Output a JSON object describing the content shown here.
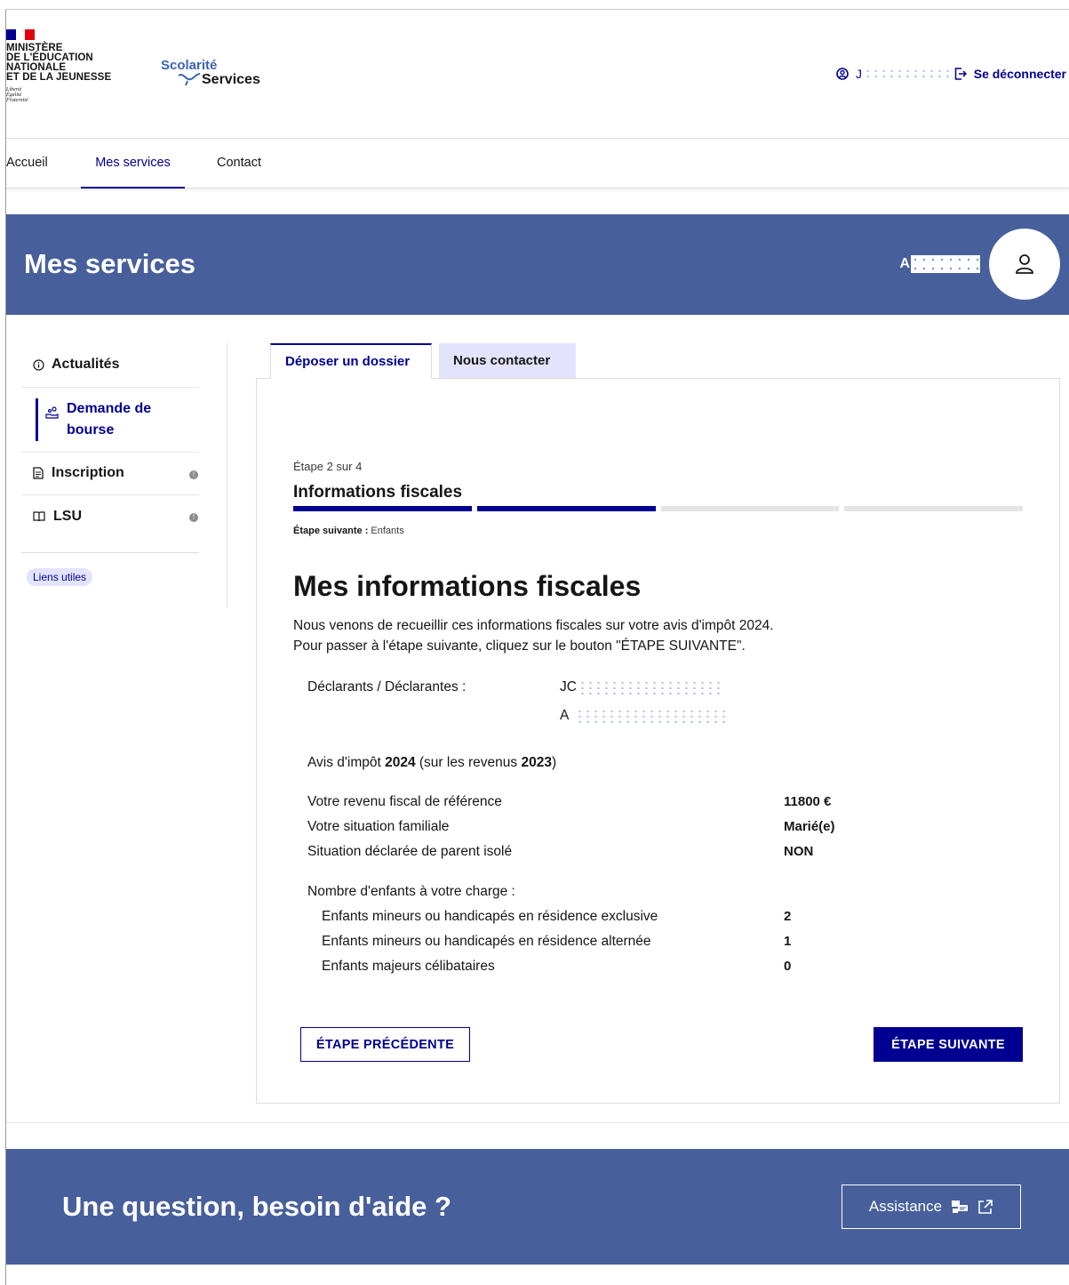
{
  "header": {
    "ministry_lines": [
      "MINISTÈRE",
      "DE L'ÉDUCATION",
      "NATIONALE",
      "ET DE LA JEUNESSE"
    ],
    "motto_lines": [
      "Liberté",
      "Égalité",
      "Fraternité"
    ],
    "logo_top": "Scolarité",
    "logo_bottom": "Services",
    "user_initial": "J",
    "logout_label": "Se déconnecter"
  },
  "nav": {
    "items": [
      "Accueil",
      "Mes services",
      "Contact"
    ],
    "active": "Mes services"
  },
  "banner": {
    "title": "Mes services",
    "user_initials": "A"
  },
  "sidebar": {
    "items": [
      {
        "label": "Actualités",
        "icon": "info-icon"
      },
      {
        "label": "Demande de bourse",
        "icon": "hand-coins-icon",
        "active": true
      },
      {
        "label": "Inscription",
        "icon": "document-icon",
        "alert": true
      },
      {
        "label": "LSU",
        "icon": "book-icon",
        "alert": true
      }
    ],
    "tag": "Liens utiles"
  },
  "tabs": [
    "Déposer un dossier",
    "Nous contacter"
  ],
  "stepper": {
    "count": "Étape 2 sur 4",
    "title": "Informations fiscales",
    "current": 2,
    "total": 4,
    "next_label": "Étape suivante :",
    "next_value": "Enfants"
  },
  "content": {
    "title": "Mes informations fiscales",
    "intro_1": "Nous venons de recueillir ces informations fiscales sur votre avis d'impôt 2024.",
    "intro_2": "Pour passer à l'étape suivante, cliquez sur le bouton \"ÉTAPE SUIVANTE\".",
    "declarants_label": "Déclarants / Déclarantes :",
    "declarant_1": "JC",
    "declarant_2": "A",
    "avis_prefix": "Avis d'impôt ",
    "avis_year": "2024",
    "avis_mid": " (sur les revenus ",
    "revenus_year": "2023",
    "avis_suffix": ")",
    "rows": [
      {
        "label": "Votre revenu fiscal de référence",
        "value": "11800 €"
      },
      {
        "label": "Votre situation familiale",
        "value": "Marié(e)"
      },
      {
        "label": "Situation déclarée de parent isolé",
        "value": "NON"
      }
    ],
    "children_label": "Nombre d'enfants à votre charge :",
    "children": [
      {
        "label": "Enfants mineurs ou handicapés en résidence exclusive",
        "value": "2"
      },
      {
        "label": "Enfants mineurs ou handicapés en résidence alternée",
        "value": "1"
      },
      {
        "label": "Enfants majeurs célibataires",
        "value": "0"
      }
    ],
    "btn_prev": "ÉTAPE PRÉCÉDENTE",
    "btn_next": "ÉTAPE SUIVANTE"
  },
  "help": {
    "title": "Une question, besoin d'aide ?",
    "button": "Assistance"
  },
  "colors": {
    "primary": "#000091",
    "banner": "#475f9b",
    "step_inactive": "#e5e5e5",
    "tag_bg": "#e3e3fd",
    "flag_blue": "#000091",
    "flag_red": "#e1000f"
  }
}
